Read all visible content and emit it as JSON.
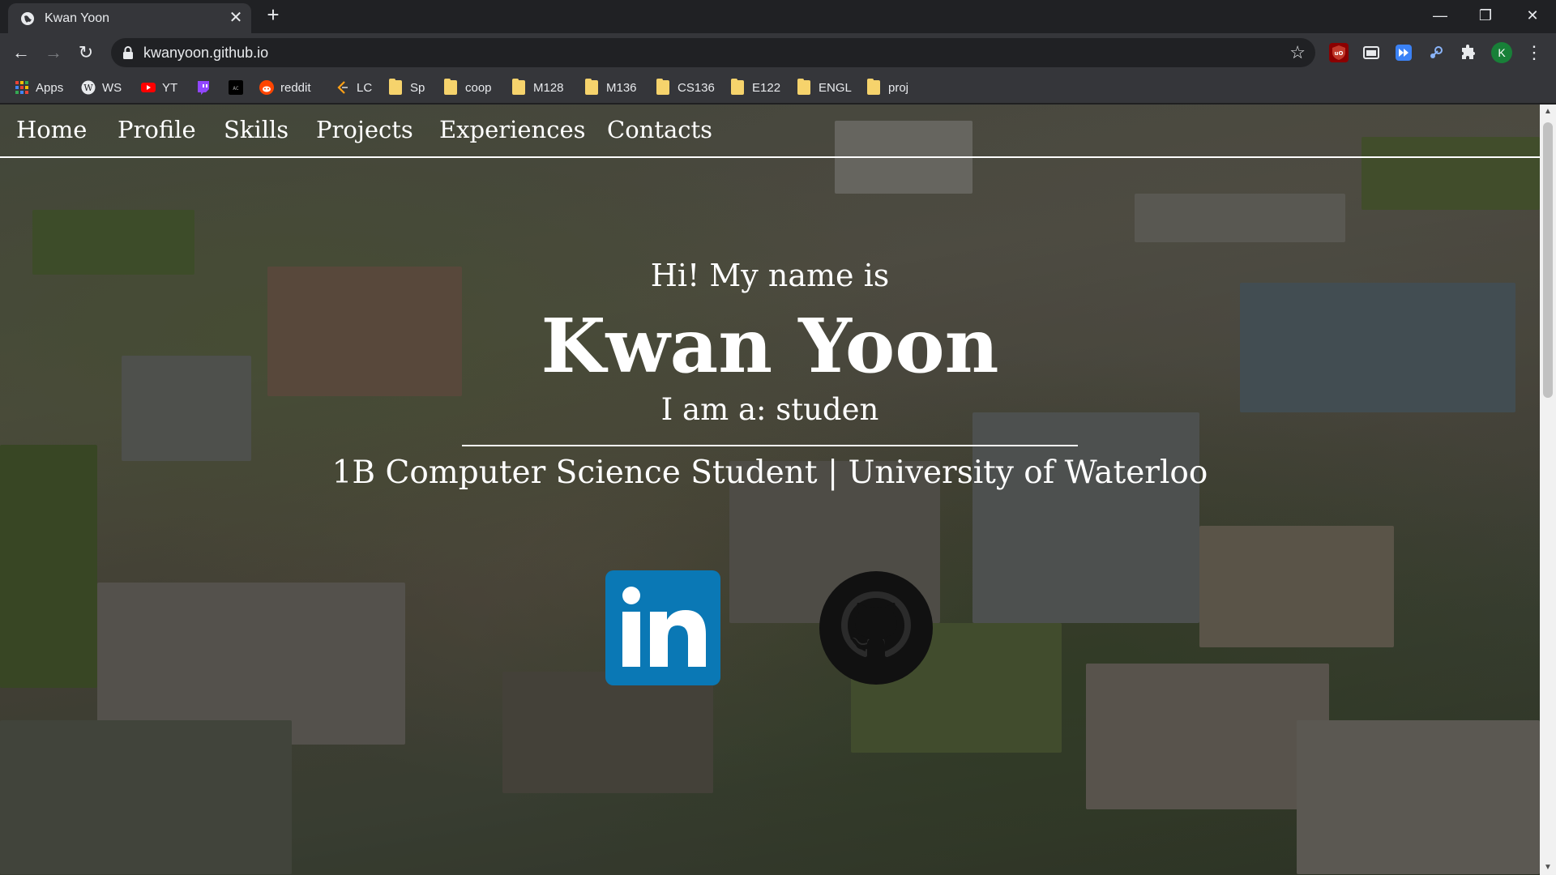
{
  "browser": {
    "tab": {
      "title": "Kwan Yoon",
      "close_glyph": "✕"
    },
    "new_tab_glyph": "+",
    "window_controls": {
      "minimize": "—",
      "restore": "❐",
      "close": "✕"
    },
    "nav": {
      "back": "←",
      "forward": "→",
      "reload": "↻"
    },
    "address": {
      "url": "kwanyoon.github.io"
    },
    "star_glyph": "☆",
    "profile_initial": "K",
    "menu_glyph": "⋮"
  },
  "bookmarks": {
    "items": [
      {
        "label": "Apps",
        "icon": "apps-grid-icon"
      },
      {
        "label": "WS",
        "icon": "wikipedia-icon"
      },
      {
        "label": "YT",
        "icon": "youtube-icon"
      },
      {
        "label": "",
        "icon": "twitch-icon"
      },
      {
        "label": "",
        "icon": "terminal-icon"
      },
      {
        "label": "reddit",
        "icon": "reddit-icon"
      },
      {
        "label": "LC",
        "icon": "leetcode-icon"
      },
      {
        "label": "Sp",
        "icon": "folder-icon"
      },
      {
        "label": "coop",
        "icon": "folder-icon"
      },
      {
        "label": "M128",
        "icon": "folder-icon"
      },
      {
        "label": "M136",
        "icon": "folder-icon"
      },
      {
        "label": "CS136",
        "icon": "folder-icon"
      },
      {
        "label": "E122",
        "icon": "folder-icon"
      },
      {
        "label": "ENGL",
        "icon": "folder-icon"
      },
      {
        "label": "proj",
        "icon": "folder-icon"
      }
    ]
  },
  "site": {
    "nav": [
      "Home",
      "Profile",
      "Skills",
      "Projects",
      "Experiences",
      "Contacts"
    ],
    "greeting": "Hi! My name is",
    "name": "Kwan Yoon",
    "role": "I am a: studen",
    "subtitle": "1B Computer Science Student | University of Waterloo",
    "social": [
      {
        "name": "LinkedIn",
        "icon": "linkedin-icon"
      },
      {
        "name": "GitHub",
        "icon": "github-icon"
      }
    ]
  },
  "colors": {
    "chrome_dark": "#202124",
    "chrome_toolbar": "#35363a",
    "linkedin_blue": "#0a78b5",
    "folder_yellow": "#f6d36c"
  }
}
